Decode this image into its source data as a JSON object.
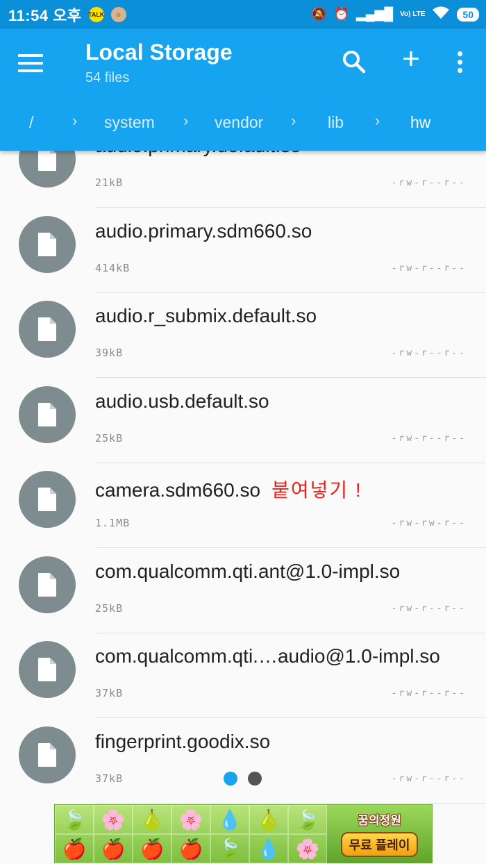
{
  "status_bar": {
    "time": "11:54 오후",
    "kakao_icon_text": "TALK",
    "network": "Vo) LTE",
    "battery": "50"
  },
  "app_bar": {
    "title": "Local Storage",
    "subtitle": "54 files",
    "breadcrumbs": [
      {
        "label": "/"
      },
      {
        "label": "system"
      },
      {
        "label": "vendor"
      },
      {
        "label": "lib"
      },
      {
        "label": "hw"
      }
    ],
    "separator": "›"
  },
  "files": [
    {
      "name": "audio.primary.default.so",
      "size": "21kB",
      "perm": "-rw-r--r--",
      "note": ""
    },
    {
      "name": "audio.primary.sdm660.so",
      "size": "414kB",
      "perm": "-rw-r--r--",
      "note": ""
    },
    {
      "name": "audio.r_submix.default.so",
      "size": "39kB",
      "perm": "-rw-r--r--",
      "note": ""
    },
    {
      "name": "audio.usb.default.so",
      "size": "25kB",
      "perm": "-rw-r--r--",
      "note": ""
    },
    {
      "name": "camera.sdm660.so",
      "size": "1.1MB",
      "perm": "-rw-rw-r--",
      "note": "붙여넣기 !"
    },
    {
      "name": "com.qualcomm.qti.ant@1.0-impl.so",
      "size": "25kB",
      "perm": "-rw-r--r--",
      "note": ""
    },
    {
      "name": "com.qualcomm.qti.…audio@1.0-impl.so",
      "size": "37kB",
      "perm": "-rw-r--r--",
      "note": ""
    },
    {
      "name": "fingerprint.goodix.so",
      "size": "37kB",
      "perm": "-rw-r--r--",
      "note": ""
    }
  ],
  "ad": {
    "logo": "꿈의정원",
    "cta": "무료 플레이",
    "tiles": [
      "🍃",
      "🌸",
      "🍐",
      "🌸",
      "💧",
      "🍐",
      "🍃",
      "🍎",
      "🍎",
      "🍎",
      "🍎",
      "🍃",
      "💧",
      "🌸"
    ]
  },
  "colors": {
    "status_bar": "#0a8fd8",
    "app_bar": "#16a3ef",
    "avatar": "#7e8b8f",
    "annotation": "#e8241f"
  }
}
